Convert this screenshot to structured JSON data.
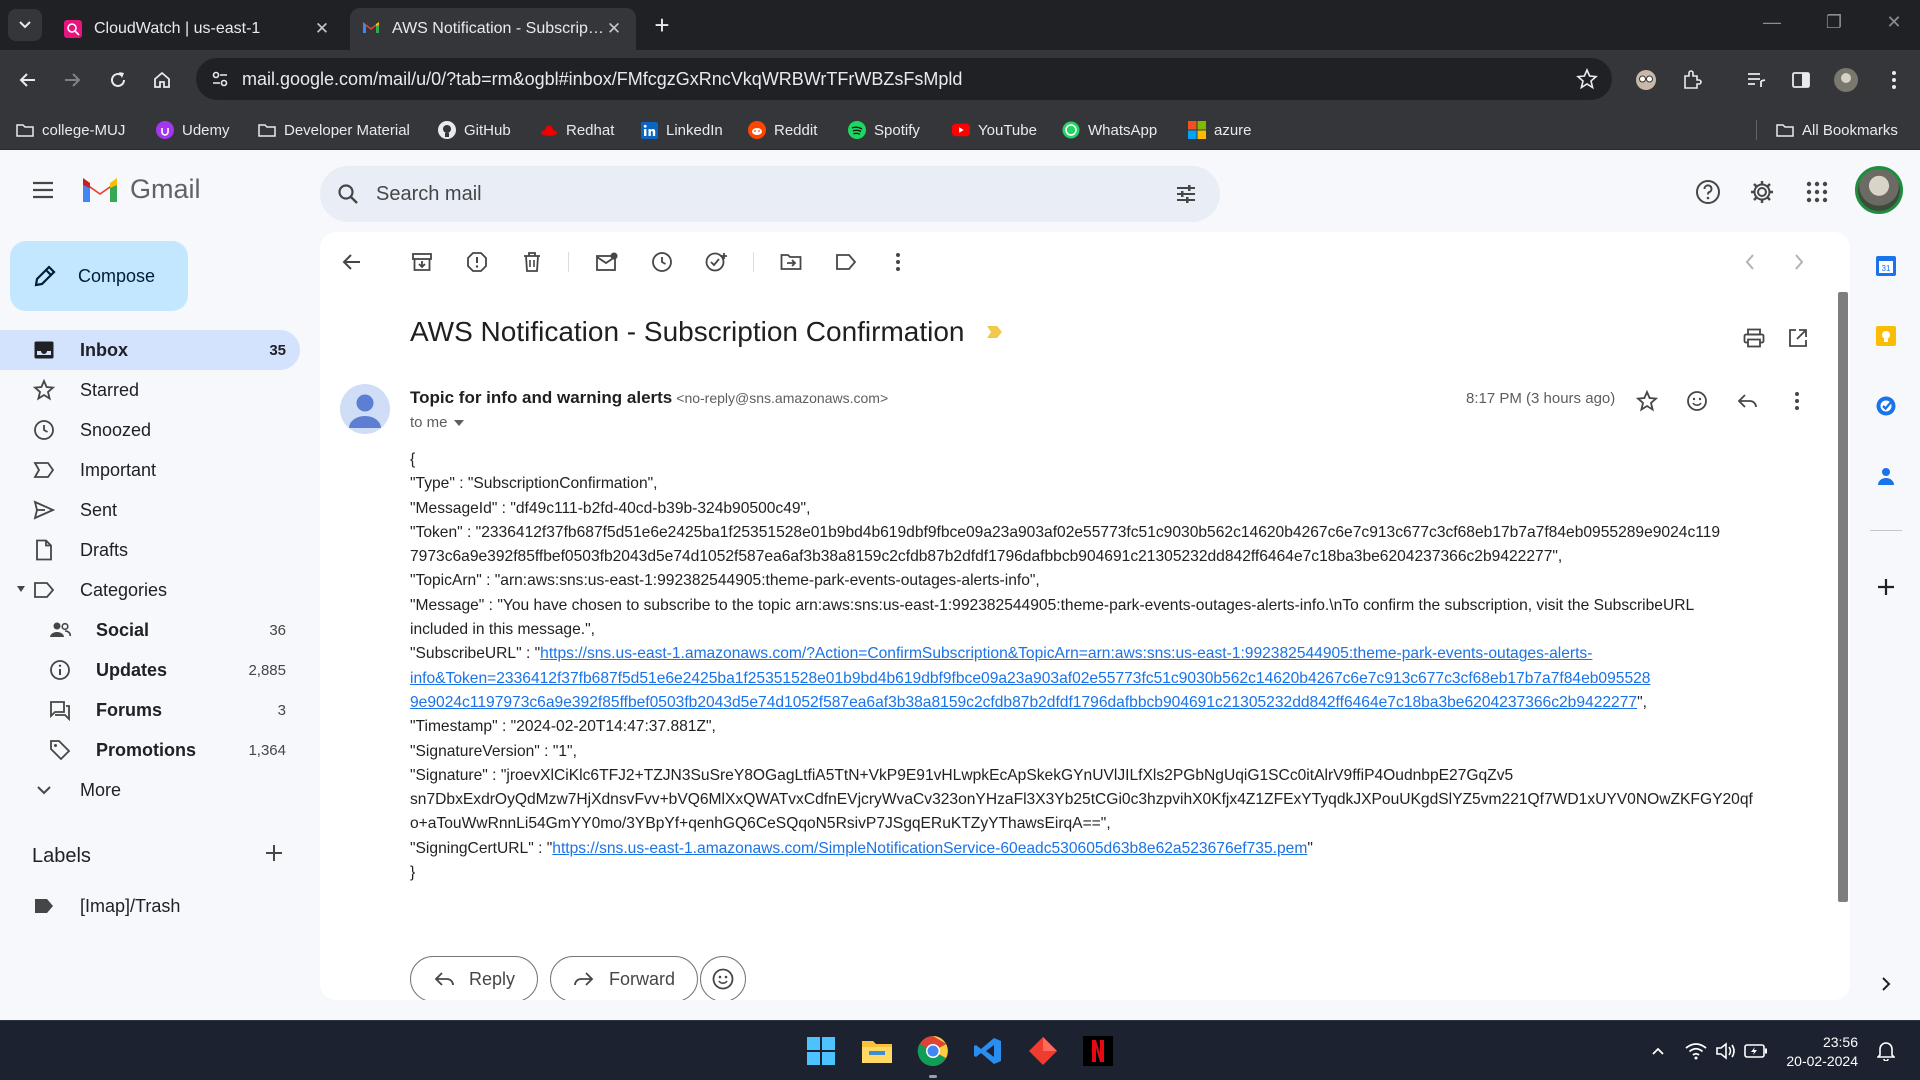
{
  "browser": {
    "tabs": [
      {
        "title": "CloudWatch | us-east-1",
        "active": false
      },
      {
        "title": "AWS Notification - Subscription Confirmation - Gmail",
        "active": true
      }
    ],
    "url": "mail.google.com/mail/u/0/?tab=rm&ogbl#inbox/FMfcgzGxRncVkqWRBWrTFrWBZsFsMpld",
    "bookmarks": [
      "college-MUJ",
      "Udemy",
      "Developer Material",
      "GitHub",
      "Redhat",
      "LinkedIn",
      "Reddit",
      "Spotify",
      "YouTube",
      "WhatsApp",
      "azure"
    ],
    "all_bookmarks": "All Bookmarks"
  },
  "gmail": {
    "logo": "Gmail",
    "search_placeholder": "Search mail",
    "compose": "Compose",
    "nav": [
      {
        "label": "Inbox",
        "count": "35"
      },
      {
        "label": "Starred",
        "count": ""
      },
      {
        "label": "Snoozed",
        "count": ""
      },
      {
        "label": "Important",
        "count": ""
      },
      {
        "label": "Sent",
        "count": ""
      },
      {
        "label": "Drafts",
        "count": ""
      },
      {
        "label": "Categories",
        "count": ""
      }
    ],
    "categories": [
      {
        "label": "Social",
        "count": "36"
      },
      {
        "label": "Updates",
        "count": "2,885"
      },
      {
        "label": "Forums",
        "count": "3"
      },
      {
        "label": "Promotions",
        "count": "1,364"
      }
    ],
    "more": "More",
    "labels_title": "Labels",
    "labels": [
      "[Imap]/Trash"
    ]
  },
  "message": {
    "subject": "AWS Notification - Subscription Confirmation",
    "sender_name": "Topic for info and warning alerts",
    "sender_email": "<no-reply@sns.amazonaws.com>",
    "to": "to me",
    "time": "8:17 PM (3 hours ago)",
    "body": {
      "l01": "{",
      "l02": "  \"Type\" : \"SubscriptionConfirmation\",",
      "l03": "  \"MessageId\" : \"df49c111-b2fd-40cd-b39b-324b90500c49\",",
      "l04": "  \"Token\" : \"2336412f37fb687f5d51e6e2425ba1f25351528e01b9bd4b619dbf9fbce09a23a903af02e55773fc51c9030b562c14620b4267c6e7c913c677c3cf68eb17b7a7f84eb0955289e9024c119",
      "l05": "7973c6a9e392f85ffbef0503fb2043d5e74d1052f587ea6af3b38a8159c2cfdb87b2dfdf1796dafbbcb904691c21305232dd842ff6464e7c18ba3be6204237366c2b9422277\",",
      "l06": "  \"TopicArn\" : \"arn:aws:sns:us-east-1:992382544905:theme-park-events-outages-alerts-info\",",
      "l07": "  \"Message\" : \"You have chosen to subscribe to the topic arn:aws:sns:us-east-1:992382544905:theme-park-events-outages-alerts-info.\\nTo confirm the subscription, visit the SubscribeURL",
      "l08": "included in this message.\",",
      "l09_pre": "  \"SubscribeURL\" : \"",
      "l09_link": "https://sns.us-east-1.amazonaws.com/?Action=ConfirmSubscription&TopicArn=arn:aws:sns:us-east-1:992382544905:theme-park-events-outages-alerts-",
      "l10_link": "info&Token=2336412f37fb687f5d51e6e2425ba1f25351528e01b9bd4b619dbf9fbce09a23a903af02e55773fc51c9030b562c14620b4267c6e7c913c677c3cf68eb17b7a7f84eb095528",
      "l11_link": "9e9024c1197973c6a9e392f85ffbef0503fb2043d5e74d1052f587ea6af3b38a8159c2cfdb87b2dfdf1796dafbbcb904691c21305232dd842ff6464e7c18ba3be6204237366c2b9422277",
      "l11_post": "\",",
      "l12": "  \"Timestamp\" : \"2024-02-20T14:47:37.881Z\",",
      "l13": "  \"SignatureVersion\" : \"1\",",
      "l14": "  \"Signature\" : \"jroevXlCiKlc6TFJ2+TZJN3SuSreY8OGagLtfiA5TtN+VkP9E91vHLwpkEcApSkekGYnUVlJILfXls2PGbNgUqiG1SCc0itAlrV9ffiP4OudnbpE27GqZv5",
      "l15": "sn7DbxExdrOyQdMzw7HjXdnsvFvv+bVQ6MlXxQWATvxCdfnEVjcryWvaCv323onYHzaFl3X3Yb25tCGi0c3hzpvihX0Kfjx4Z1ZFExYTyqdkJXPouUKgdSlYZ5vm221Qf7WD1xUYV0NOwZKFGY20qf",
      "l16": "o+aTouWwRnnLi54GmYY0mo/3YBpYf+qenhGQ6CeSQqoN5RsivP7JSgqERuKTZyYThawsEirqA==\",",
      "l17_pre": "  \"SigningCertURL\" : \"",
      "l17_link": "https://sns.us-east-1.amazonaws.com/SimpleNotificationService-60eadc530605d63b8e62a523676ef735.pem",
      "l17_post": "\"",
      "l18": "}"
    },
    "reply": "Reply",
    "forward": "Forward"
  },
  "taskbar": {
    "time": "23:56",
    "date": "20-02-2024"
  },
  "colors": {
    "gmail_bg": "#f6f8fc",
    "compose_bg": "#c2e7ff",
    "inbox_active": "#d3e3fd",
    "link": "#1a73e8",
    "chrome_dark": "#35363a"
  }
}
